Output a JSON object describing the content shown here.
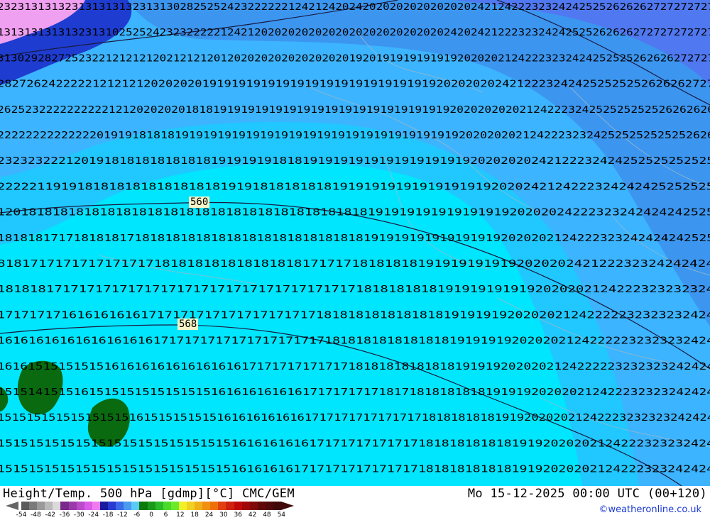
{
  "map": {
    "contour_labels": [
      "560",
      "568"
    ],
    "grid_value_rows": [
      "2323131313231313131323131302825252423222222124212420242020202020202020242124222323242425252626262727272727",
      "1313131313132313102525242323222221242120202020202020202020202020202420242122232324242525262626272727272727",
      "3130292827252322121212120212121201202020202020202020192019191919191920202021242223232424252525262626272727",
      "28272624222221212121202020201919191919191919191919191919191920202020242122232424252525252626262727",
      "2625232222222222121202020201818191919191919191919191919191919191920202020202124222324252525252526262626",
      "22222222222222019191818181919191919191919191919191919191919191919202020202124222323242525252525252626",
      "2323232221201918181818181818191919191818191919191919191919191920202020242122232424252525252525",
      "222221191918181818181818181819191818181818191919191919191919192020242124222324242425252525",
      "1201818181818181818181818181818181818181818181819191919191919191920202024222323242424242525",
      "1818181717181818171818181818181818181818181818181919191919191919192020202124222323242424242525",
      "818171717171717171718181818181818181817171718181818191919191919202020242122232324242424",
      "1818181717171717171717171717171717171717171718181818181919191919192020202124222323232324",
      "171717171616161616171717171717171717171718181818181818181919191920202021242222232323232424",
      "16161616161616161616171717171717171717171718181818181818181919191920202021242222232323232424",
      "1616151515151516161616161616161617171717171717181818181818181919192020202124222223232323242424",
      "1515141515161515151515151515161616161616171717171718171818181818191919202020212422232323242424",
      "15151515151515151516151515151516161616161617171717171717171818181818191920202021242223232323242424",
      "15151515151515151515151515151516161616161717171717171718181818181819192020202124222323232424",
      "15151515151515151515151515151516161616171717171717171718181818181819192020202124222323242424"
    ]
  },
  "footer": {
    "title": "Height/Temp. 500 hPa [gdmp][°C] CMC/GEM",
    "valid_time": "Mo 15-12-2025 00:00 UTC (00+120)",
    "credit": "©weatheronline.co.uk",
    "scale_ticks": [
      "-54",
      "-48",
      "-42",
      "-36",
      "-30",
      "-24",
      "-18",
      "-12",
      "-6",
      "0",
      "6",
      "12",
      "18",
      "24",
      "30",
      "36",
      "42",
      "48",
      "54"
    ],
    "scale_colors": [
      "#5a5a5a",
      "#7a7a7a",
      "#9a9a9a",
      "#bababa",
      "#dadada",
      "#7a2a8a",
      "#9a3aaa",
      "#ba4aca",
      "#da5aea",
      "#f07af0",
      "#1a1aa0",
      "#2a3ad0",
      "#3a6ae8",
      "#4a9af0",
      "#5acaf8",
      "#0a7a0a",
      "#1a9a1a",
      "#2aba2a",
      "#4ada2a",
      "#6aea2a",
      "#f0f02a",
      "#f0d020",
      "#f0b018",
      "#f09010",
      "#f07008",
      "#e04010",
      "#d02010",
      "#c00808",
      "#a00808",
      "#800808",
      "#600808",
      "#500808",
      "#400808"
    ]
  }
}
